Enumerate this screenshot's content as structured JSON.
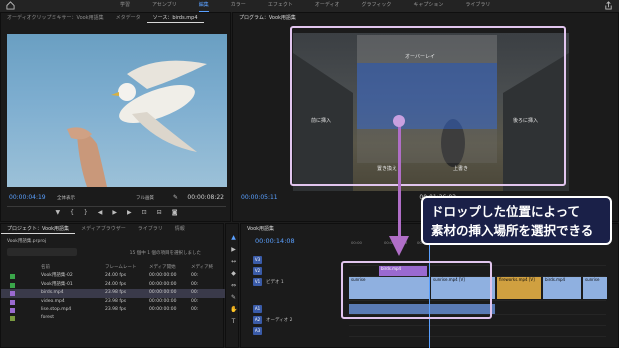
{
  "nav": {
    "items": [
      "学習",
      "アセンブリ",
      "編集",
      "カラー",
      "エフェクト",
      "オーディオ",
      "グラフィック",
      "キャプション",
      "ライブラリ"
    ],
    "active_index": 2,
    "accent": "#5aa0ff"
  },
  "source_panel": {
    "tabs": [
      "オーディオクリップミキサー：Vook用語集",
      "メタデータ",
      "ソース：birds.mp4"
    ],
    "active_index": 2,
    "timecode_in": "00:00:04:19",
    "fit_label": "全体表示",
    "quality_label": "フル画質",
    "timecode_dur": "00:00:08:22"
  },
  "program_panel": {
    "tab": "プログラム：Vook用語集",
    "timecode_in": "00:00:05:11",
    "timecode_dur": "00:01:26:03",
    "overlay_labels": {
      "top": "オーバーレイ",
      "left": "前に挿入",
      "right": "後ろに挿入",
      "bottom_left": "置き換え",
      "bottom_right": "上書き"
    },
    "highlight_color": "#e1c5ee"
  },
  "callout": {
    "line1": "ドロップした位置によって",
    "line2": "素材の挿入場所を選択できる"
  },
  "project_panel": {
    "tabs": [
      "プロジェクト：Vook用語集",
      "メディアブラウザー",
      "ライブラリ",
      "情報"
    ],
    "active_index": 0,
    "path": "Vook用語集.prproj",
    "count": "15 個中 1 個の項目を選択しました",
    "columns": [
      "名前",
      "フレームレート",
      "メディア開始",
      "メディア終"
    ],
    "rows": [
      {
        "name": "Vook用語集-02",
        "fps": "24.00 fps",
        "start": "00:00:00:00",
        "end": "00:",
        "color": "#3aa64a"
      },
      {
        "name": "Vook用語集-01",
        "fps": "24.00 fps",
        "start": "00:00:00:00",
        "end": "00:",
        "color": "#3aa64a"
      },
      {
        "name": "birds.mp4",
        "fps": "23.98 fps",
        "start": "00:00:00:00",
        "end": "00:",
        "color": "#9a6ad0"
      },
      {
        "name": "video.mp4",
        "fps": "23.98 fps",
        "start": "00:00:00:00",
        "end": "00:",
        "color": "#9a6ad0"
      },
      {
        "name": "lise.stop.mp4",
        "fps": "23.98 fps",
        "start": "00:00:00:00",
        "end": "00:",
        "color": "#9a6ad0"
      },
      {
        "name": "forest",
        "fps": "",
        "start": "",
        "end": "",
        "color": "#7a9a40"
      }
    ]
  },
  "timeline": {
    "tab": "Vook用語集",
    "timecode": "00:00:14:08",
    "ticks": [
      "00:00",
      "00:00:04:23",
      "00:00:09:23",
      "00:00:14:23",
      "00:00:19:23",
      "00:00:24:23",
      "00:00:29:23",
      "00:00:34:23"
    ],
    "tracks": [
      {
        "target": "V3",
        "name": ""
      },
      {
        "target": "V2",
        "name": ""
      },
      {
        "target": "V1",
        "name": "ビデオ 1"
      },
      {
        "target": "A1",
        "name": ""
      },
      {
        "target": "A2",
        "name": "オーディオ 2"
      },
      {
        "target": "A3",
        "name": ""
      }
    ],
    "clips": {
      "birds": "birds.mp4",
      "sunrise": "sunrise",
      "sunrise_v": "sunrise.mp4 [V]",
      "fireworks": "fireworks.mp4 [V]",
      "birds2": "birds.mp4",
      "sunrise2": "sunrise"
    }
  }
}
